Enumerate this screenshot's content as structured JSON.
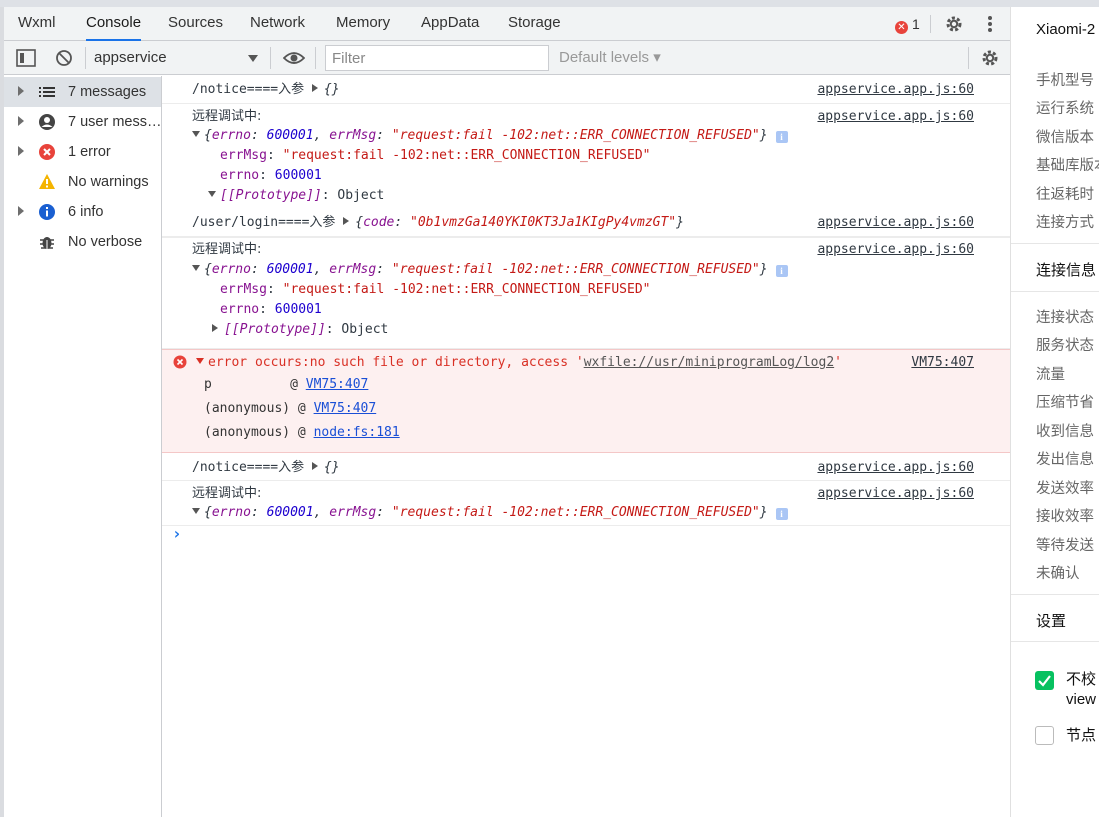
{
  "tabs": [
    "Wxml",
    "Console",
    "Sources",
    "Network",
    "Memory",
    "AppData",
    "Storage"
  ],
  "active_tab": "Console",
  "error_badge_count": "1",
  "toolbar": {
    "context": "appservice",
    "filter_placeholder": "Filter",
    "levels": "Default levels ▾"
  },
  "sidebar": [
    {
      "label": "7 messages",
      "icon": "list-icon",
      "expandable": true
    },
    {
      "label": "7 user mess…",
      "icon": "user-icon",
      "expandable": true
    },
    {
      "label": "1 error",
      "icon": "error-icon",
      "expandable": true
    },
    {
      "label": "No warnings",
      "icon": "warning-icon",
      "expandable": false
    },
    {
      "label": "6 info",
      "icon": "info-icon",
      "expandable": true
    },
    {
      "label": "No verbose",
      "icon": "bug-icon",
      "expandable": false
    }
  ],
  "console": {
    "source": "appservice.app.js:60",
    "notice_prefix": "/notice====入参 ",
    "notice_obj": "{}",
    "remote_debug": "远程调试中:",
    "err_obj_open": "{",
    "err_key_errno": "errno",
    "err_key_errmsg": "errMsg",
    "err_colon": ": ",
    "err_comma": ", ",
    "errno_value": "600001",
    "errmsg_value": "\"request:fail -102:net::ERR_CONNECTION_REFUSED\"",
    "err_obj_close": "}",
    "prototype_key": "[[Prototype]]",
    "prototype_value": ": Object",
    "login_prefix": "/user/login====入参 ",
    "login_obj_open": "{",
    "login_key": "code",
    "login_value": "\"0b1vmzGa140YKI0KT3Ja1KIgPy4vmzGT\"",
    "login_obj_close": "}",
    "error_message": "error occurs:no such file or directory, access '",
    "error_path": "wxfile://usr/miniprogramLog/log2",
    "error_message_end": "'",
    "error_source": "VM75:407",
    "stack": [
      {
        "fn": "p          ",
        "at": "@ ",
        "loc": "VM75:407"
      },
      {
        "fn": "(anonymous)",
        "at": " @ ",
        "loc": "VM75:407"
      },
      {
        "fn": "(anonymous)",
        "at": " @ ",
        "loc": "node:fs:181"
      }
    ],
    "info_glyph": "i",
    "prompt": "›"
  },
  "right_panel": {
    "device": "Xiaomi-2",
    "info_items": [
      "手机型号",
      "运行系统",
      "微信版本",
      "基础库版本",
      "往返耗时",
      "连接方式"
    ],
    "conn_header": "连接信息",
    "conn_items": [
      "连接状态",
      "服务状态",
      "流量",
      "压缩节省",
      "收到信息",
      "发出信息",
      "发送效率",
      "接收效率",
      "等待发送",
      "未确认"
    ],
    "settings_header": "设置",
    "checkbox1": "不校",
    "checkbox1_line2": "view",
    "checkbox2": "节点"
  },
  "colors": {
    "accent": "#1a73e8",
    "error": "#d93025",
    "string": "#c41a16",
    "number": "#1c00cf",
    "key": "#881391",
    "wechat_green": "#07c160"
  }
}
